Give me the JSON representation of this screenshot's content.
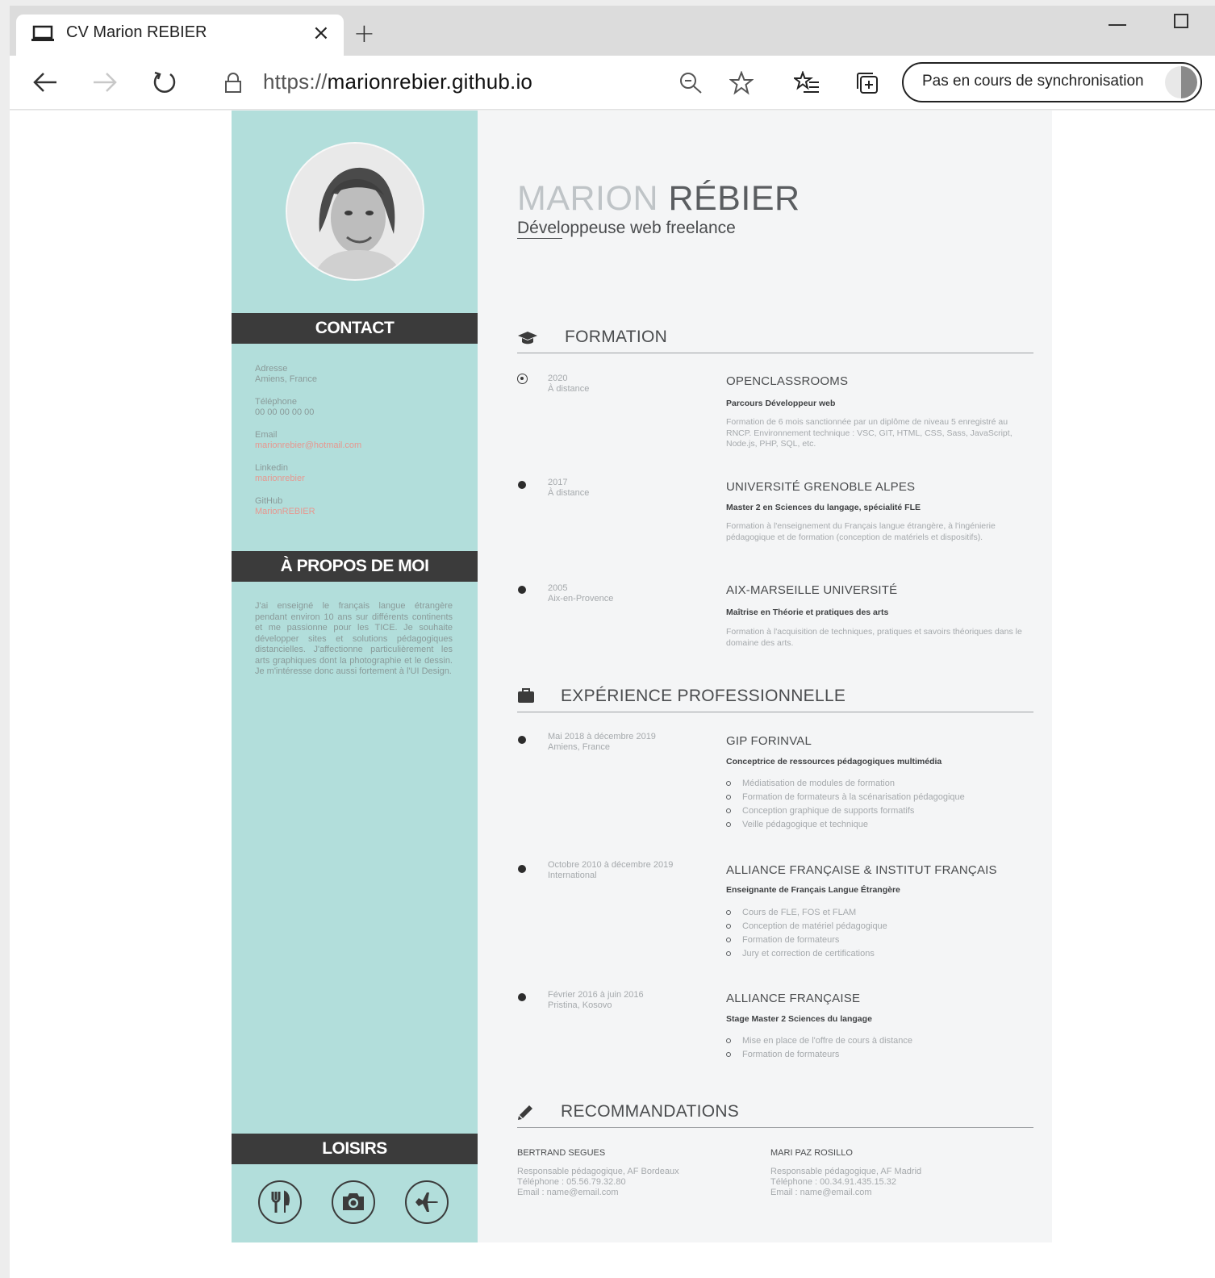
{
  "browser": {
    "tab_title": "CV Marion REBIER",
    "tab_close": "×",
    "new_tab": "+",
    "url_protocol": "https://",
    "url_host": "marionrebier.github.io",
    "sync_label": "Pas en cours de synchronisation"
  },
  "sidebar": {
    "contact_heading": "CONTACT",
    "contact": [
      {
        "label": "Adresse",
        "value": "Amiens, France",
        "link": false
      },
      {
        "label": "Téléphone",
        "value": "00 00 00 00 00",
        "link": false
      },
      {
        "label": "Email",
        "value": "marionrebier@hotmail.com",
        "link": true
      },
      {
        "label": "Linkedin",
        "value": "marionrebier",
        "link": true
      },
      {
        "label": "GitHub",
        "value": "MarionREBIER",
        "link": true
      }
    ],
    "about_heading": "À PROPOS DE MOI",
    "about_text": "J'ai enseigné le français langue étrangère pendant environ 10 ans sur différents continents et me passionne pour les TICE. Je souhaite développer sites et solutions pédagogiques distancielles. J'affectionne particulièrement les arts graphiques dont la photographie et le dessin. Je m'intéresse donc aussi fortement à l'UI Design.",
    "hobbies_heading": "LOISIRS",
    "hobbies": [
      "cutlery-icon",
      "camera-icon",
      "plane-icon"
    ]
  },
  "header": {
    "first_name": "MARION",
    "last_name": "RÉBIER",
    "subtitle": "Développeuse web freelance"
  },
  "formation": {
    "title": "FORMATION",
    "items": [
      {
        "year": "2020",
        "place": "À distance",
        "school": "OPENCLASSROOMS",
        "degree": "Parcours Développeur web",
        "desc": "Formation de 6 mois sanctionnée par un diplôme de niveau 5 enregistré au RNCP. Environnement technique : VSC, GIT, HTML, CSS, Sass, JavaScript, Node.js, PHP, SQL, etc."
      },
      {
        "year": "2017",
        "place": "À distance",
        "school": "UNIVERSITÉ GRENOBLE ALPES",
        "degree": "Master 2 en Sciences du langage, spécialité FLE",
        "desc": "Formation à l'enseignement du Français langue étrangère, à l'ingénierie pédagogique et de formation (conception de matériels et dispositifs)."
      },
      {
        "year": "2005",
        "place": "Aix-en-Provence",
        "school": "AIX-MARSEILLE UNIVERSITÉ",
        "degree": "Maîtrise en Théorie et pratiques des arts",
        "desc": "Formation à l'acquisition de techniques, pratiques et savoirs théoriques dans le domaine des arts."
      }
    ]
  },
  "experience": {
    "title": "EXPÉRIENCE PROFESSIONNELLE",
    "items": [
      {
        "date": "Mai 2018 à décembre 2019",
        "place": "Amiens, France",
        "company": "GIP FORINVAL",
        "role": "Conceptrice de ressources pédagogiques multimédia",
        "tasks": [
          "Médiatisation de modules de formation",
          "Formation de formateurs à la scénarisation pédagogique",
          "Conception graphique de supports formatifs",
          "Veille pédagogique et technique"
        ]
      },
      {
        "date": "Octobre 2010 à décembre 2019",
        "place": "International",
        "company": "ALLIANCE FRANÇAISE & INSTITUT FRANÇAIS",
        "role": "Enseignante de Français Langue Étrangère",
        "tasks": [
          "Cours de FLE, FOS et FLAM",
          "Conception de matériel pédagogique",
          "Formation de formateurs",
          "Jury et correction de certifications"
        ]
      },
      {
        "date": "Février 2016 à juin 2016",
        "place": "Pristina, Kosovo",
        "company": "ALLIANCE FRANÇAISE",
        "role": "Stage Master 2 Sciences du langage",
        "tasks": [
          "Mise en place de l'offre de cours à distance",
          "Formation de formateurs"
        ]
      }
    ]
  },
  "recommandations": {
    "title": "RECOMMANDATIONS",
    "items": [
      {
        "name": "BERTRAND SEGUES",
        "role": "Responsable pédagogique, AF Bordeaux",
        "phone": "Téléphone : 05.56.79.32.80",
        "email": "Email : name@email.com"
      },
      {
        "name": "MARI PAZ ROSILLO",
        "role": "Responsable pédagogique, AF Madrid",
        "phone": "Téléphone : 00.34.91.435.15.32",
        "email": "Email : name@email.com"
      }
    ]
  },
  "colors": {
    "sidebar_bg": "#b2dedb",
    "heading_bg": "#3b3b3b",
    "link": "#e7978f",
    "main_bg": "#f4f5f6"
  }
}
